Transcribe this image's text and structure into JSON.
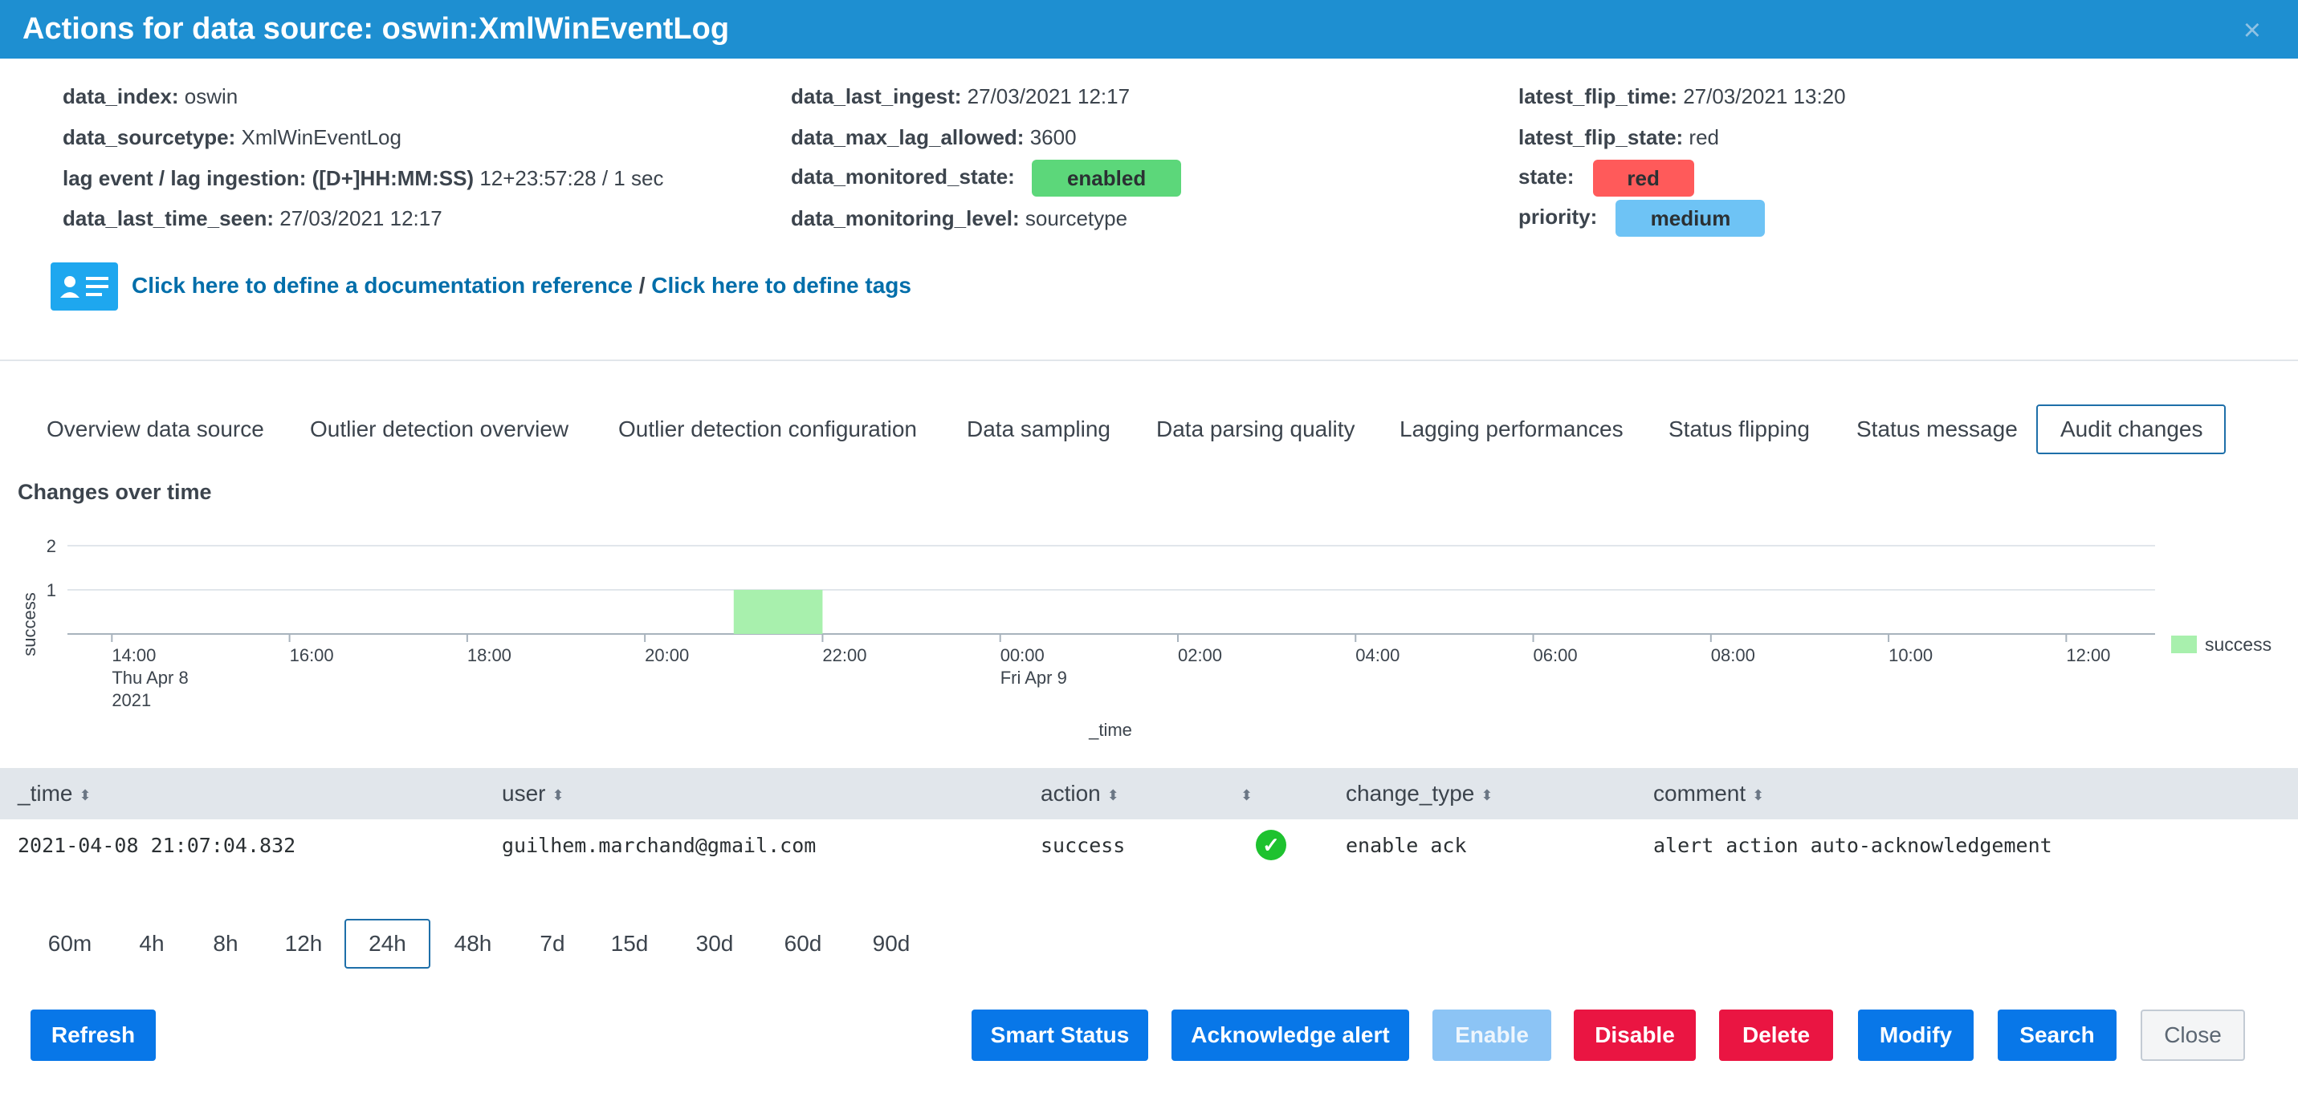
{
  "header": {
    "title": "Actions for data source: oswin:XmlWinEventLog",
    "close_icon": "×"
  },
  "info": {
    "col1": [
      {
        "key": "data_index:",
        "value": "oswin"
      },
      {
        "key": "data_sourcetype:",
        "value": "XmlWinEventLog"
      },
      {
        "key": "lag event / lag ingestion: ([D+]HH:MM:SS)",
        "value": "12+23:57:28 / 1 sec"
      },
      {
        "key": "data_last_time_seen:",
        "value": "27/03/2021 12:17"
      }
    ],
    "col2": [
      {
        "key": "data_last_ingest:",
        "value": "27/03/2021 12:17"
      },
      {
        "key": "data_max_lag_allowed:",
        "value": "3600"
      },
      {
        "key": "data_monitored_state:",
        "value": "enabled"
      },
      {
        "key": "data_monitoring_level:",
        "value": "sourcetype"
      }
    ],
    "col3": [
      {
        "key": "latest_flip_time:",
        "value": "27/03/2021 13:20"
      },
      {
        "key": "latest_flip_state:",
        "value": "red"
      },
      {
        "key": "state:",
        "value": "red"
      },
      {
        "key": "priority:",
        "value": "medium"
      }
    ],
    "colors": {
      "enabled": "#5cd77a",
      "red": "#ff5a5a",
      "medium": "#6ec3f5"
    }
  },
  "links": {
    "icon": "id-card-icon",
    "doc_reference": "Click here to define a documentation reference",
    "separator": "/",
    "tags": "Click here to define tags"
  },
  "tabs": [
    "Overview data source",
    "Outlier detection overview",
    "Outlier detection configuration",
    "Data sampling",
    "Data parsing quality",
    "Lagging performances",
    "Status flipping",
    "Status message",
    "Audit changes"
  ],
  "active_tab": "Audit changes",
  "section_title": "Changes over time",
  "chart_data": {
    "type": "bar",
    "ylabel": "success",
    "xlabel": "_time",
    "ylim": [
      0,
      2
    ],
    "yticks": [
      "2",
      "1"
    ],
    "xticks": [
      [
        "14:00",
        "Thu Apr 8",
        "2021"
      ],
      [
        "16:00"
      ],
      [
        "18:00"
      ],
      [
        "20:00"
      ],
      [
        "22:00"
      ],
      [
        "00:00",
        "Fri Apr 9"
      ],
      [
        "02:00"
      ],
      [
        "04:00"
      ],
      [
        "06:00"
      ],
      [
        "08:00"
      ],
      [
        "10:00"
      ],
      [
        "12:00"
      ]
    ],
    "series": [
      {
        "name": "success",
        "color": "#a8f0ad",
        "bins": [
          {
            "start": "2021-04-08 21:00",
            "end": "2021-04-08 22:00",
            "value": 1
          }
        ]
      }
    ],
    "x_range": [
      "2021-04-08 13:30",
      "2021-04-09 13:00"
    ],
    "legend": "right",
    "grid": true
  },
  "table": {
    "headers": [
      "_time",
      "user",
      "action",
      "",
      "change_type",
      "comment"
    ],
    "rows": [
      [
        "2021-04-08 21:07:04.832",
        "guilhem.marchand@gmail.com",
        "success",
        "check-icon",
        "enable ack",
        "alert action auto-acknowledgement"
      ]
    ]
  },
  "time_buttons": [
    "60m",
    "4h",
    "8h",
    "12h",
    "24h",
    "48h",
    "7d",
    "15d",
    "30d",
    "60d",
    "90d"
  ],
  "active_time": "24h",
  "buttons": {
    "refresh": "Refresh",
    "smart_status": "Smart Status",
    "acknowledge": "Acknowledge alert",
    "enable": "Enable",
    "disable": "Disable",
    "delete": "Delete",
    "modify": "Modify",
    "search": "Search",
    "close": "Close"
  }
}
